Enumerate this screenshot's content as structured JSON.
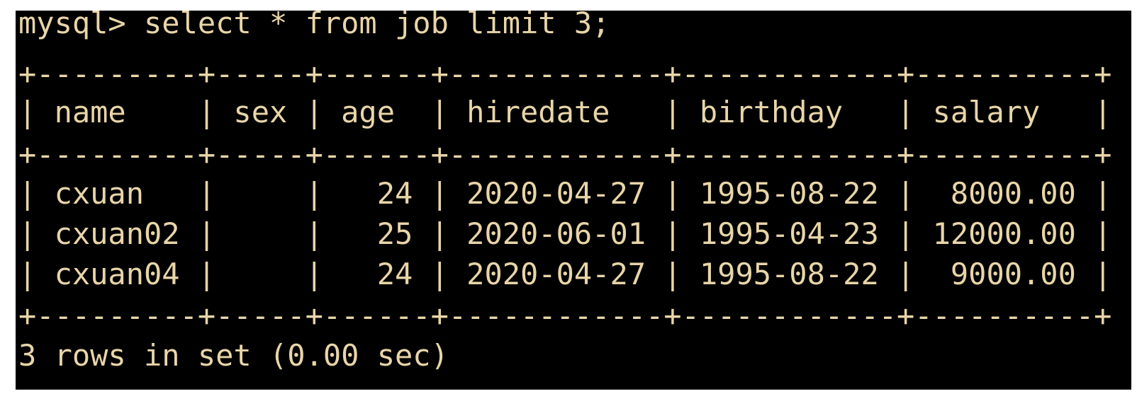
{
  "terminal": {
    "prompt_line": "mysql> select * from job limit 3;",
    "border": "+---------+-----+------+------------+------------+----------+",
    "header": "| name    | sex | age  | hiredate   | birthday   | salary   |",
    "rows": [
      "| cxuan   |     |   24 | 2020-04-27 | 1995-08-22 |  8000.00 |",
      "| cxuan02 |     |   25 | 2020-06-01 | 1995-04-23 | 12000.00 |",
      "| cxuan04 |     |   24 | 2020-04-27 | 1995-08-22 |  9000.00 |"
    ],
    "status_line": "3 rows in set (0.00 sec)",
    "colors": {
      "background": "#000000",
      "text": "#e8d5a8"
    }
  }
}
